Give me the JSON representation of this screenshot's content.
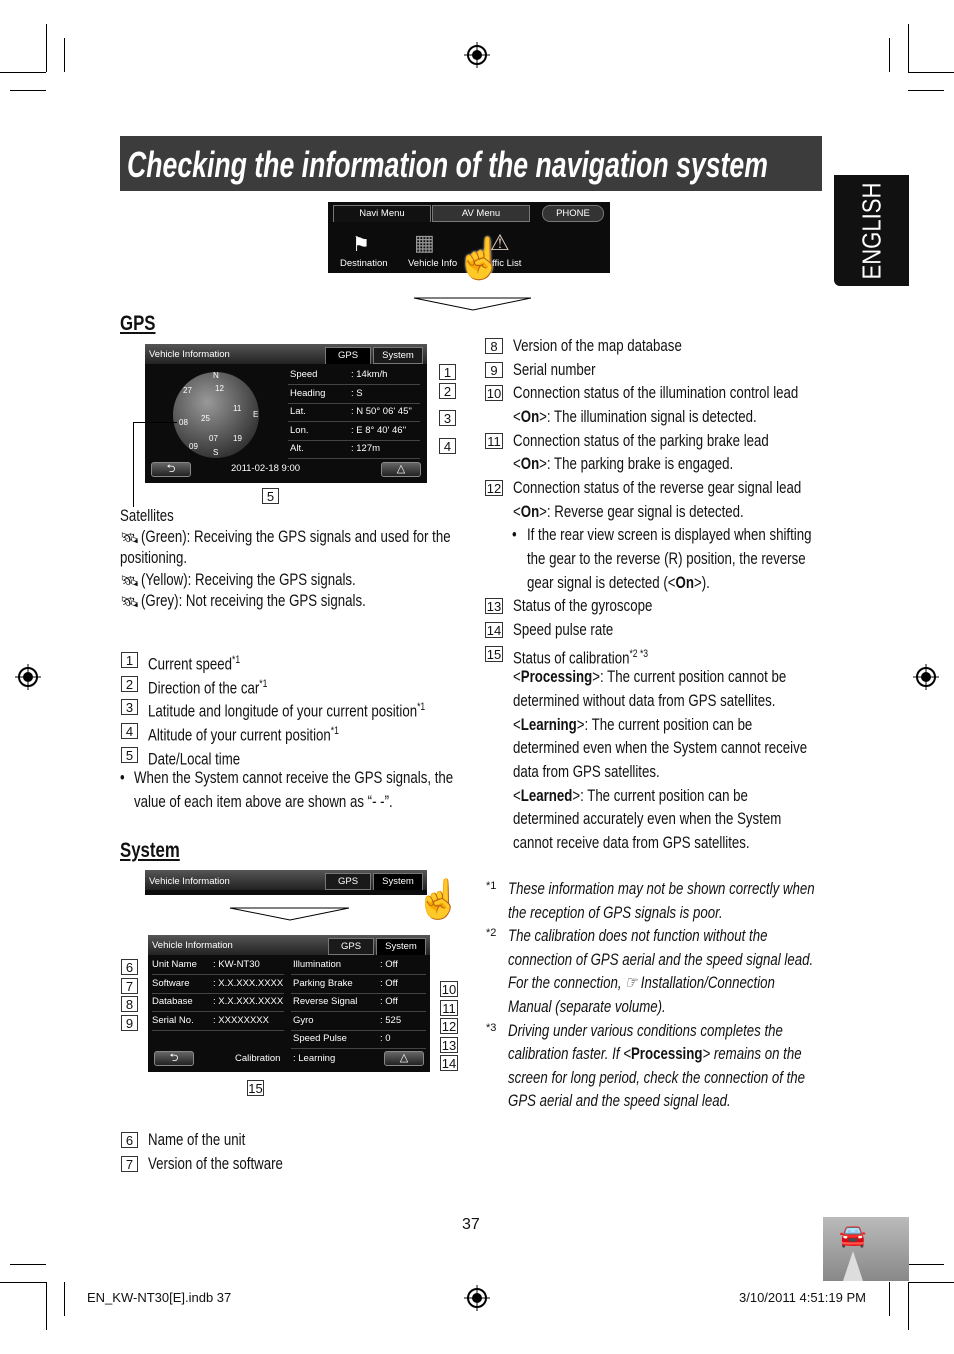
{
  "title": "Checking the information of the navigation system",
  "language_tab": "ENGLISH",
  "menu_screen": {
    "tabs": [
      "Navi Menu",
      "AV Menu",
      "PHONE"
    ],
    "items": [
      "Destination",
      "Vehicle Info",
      "Traffic List"
    ],
    "visible_items": [
      "Destination",
      "Vehicle Info",
      "ffic List"
    ]
  },
  "gps": {
    "heading": "GPS",
    "screen": {
      "title": "Vehicle Information",
      "tabs": [
        "GPS",
        "System"
      ],
      "rows": [
        {
          "label": "Speed",
          "value": ": 14km/h",
          "num": "1"
        },
        {
          "label": "Heading",
          "value": ": S",
          "num": "2"
        },
        {
          "label": "Lat.",
          "value": ": N 50° 06' 45''",
          "num": "3"
        },
        {
          "label": "Lon.",
          "value": ": E 8° 40' 46''",
          "num": ""
        },
        {
          "label": "Alt.",
          "value": ": 127m",
          "num": "4"
        }
      ],
      "satellites": [
        "27",
        "12",
        "25",
        "11",
        "08",
        "07",
        "19",
        "09"
      ],
      "compass": [
        "N",
        "E",
        "S",
        "W"
      ],
      "datetime": "2011-02-18   9:00",
      "datetime_num": "5"
    },
    "satellites_label": "Satellites",
    "satellite_notes": [
      "(Green): Receiving the GPS signals and used for the",
      "positioning.",
      "(Yellow): Receiving the GPS signals.",
      "(Grey): Not receiving the GPS signals."
    ],
    "items": [
      {
        "num": "1",
        "text": "Current speed",
        "sup": "*1"
      },
      {
        "num": "2",
        "text": "Direction of the car",
        "sup": "*1"
      },
      {
        "num": "3",
        "text": "Latitude and longitude of your current position",
        "sup": "*1"
      },
      {
        "num": "4",
        "text": "Altitude of your current position",
        "sup": "*1"
      },
      {
        "num": "5",
        "text": "Date/Local time",
        "sup": ""
      }
    ],
    "bullet": [
      "When the System cannot receive the GPS signals, the",
      "value of each item above are shown as “- -”."
    ]
  },
  "system": {
    "heading": "System",
    "tab_screen": {
      "title": "Vehicle Information",
      "tabs": [
        "GPS",
        "System"
      ]
    },
    "screen": {
      "title": "Vehicle Information",
      "tabs": [
        "GPS",
        "System"
      ],
      "left": [
        {
          "num": "6",
          "label": "Unit Name",
          "value": ": KW-NT30"
        },
        {
          "num": "7",
          "label": "Software",
          "value": ": X.X.XXX.XXXX"
        },
        {
          "num": "8",
          "label": "Database",
          "value": ": X.X.XXX.XXXX"
        },
        {
          "num": "9",
          "label": "Serial No.",
          "value": ": XXXXXXXX"
        }
      ],
      "right": [
        {
          "num": "10",
          "label": "Illumination",
          "value": ": Off"
        },
        {
          "num": "11",
          "label": "Parking Brake",
          "value": ": Off"
        },
        {
          "num": "12",
          "label": "Reverse Signal",
          "value": ": Off"
        },
        {
          "num": "13",
          "label": "Gyro",
          "value": ": 525"
        },
        {
          "num": "14",
          "label": "Speed Pulse",
          "value": ": 0"
        }
      ],
      "calibration_label": "Calibration",
      "calibration_value": ": Learning",
      "calibration_num": "15"
    },
    "items": [
      {
        "num": "6",
        "text": "Name of the unit"
      },
      {
        "num": "7",
        "text": "Version of the software"
      }
    ]
  },
  "right_column": [
    {
      "num": "8",
      "pre": "Version of the map database"
    },
    {
      "num": "9",
      "pre": "Serial number"
    },
    {
      "num": "10",
      "pre": "Connection status of the illumination control lead"
    },
    {
      "indent": 1,
      "pre": "<",
      "bold": "On",
      "post": ">: The illumination signal is detected."
    },
    {
      "num": "11",
      "pre": "Connection status of the parking brake lead"
    },
    {
      "indent": 1,
      "pre": "<",
      "bold": "On",
      "post": ">: The parking brake is engaged."
    },
    {
      "num": "12",
      "pre": "Connection status of the reverse gear signal lead"
    },
    {
      "indent": 1,
      "pre": "<",
      "bold": "On",
      "post": ">: Reverse gear signal is detected."
    },
    {
      "indent": 2,
      "bullet": "•",
      "pre": "If the rear view screen is displayed when shifting"
    },
    {
      "indent": 2,
      "pre": "the gear to the reverse (R) position, the reverse"
    },
    {
      "indent": 2,
      "pre": "gear signal is detected (<",
      "bold": "On",
      "post": ">)."
    },
    {
      "num": "13",
      "pre": "Status of the gyroscope"
    },
    {
      "num": "14",
      "pre": "Speed pulse rate"
    },
    {
      "num": "15",
      "pre": "Status of calibration",
      "sup": "*2 *3"
    },
    {
      "indent": 1,
      "pre": "<",
      "bold": "Processing",
      "post": ">: The current position cannot be"
    },
    {
      "indent": 1,
      "pre": "determined without data from GPS satellites."
    },
    {
      "indent": 1,
      "pre": "<",
      "bold": "Learning",
      "post": ">: The current position can be"
    },
    {
      "indent": 1,
      "pre": "determined even when the System cannot receive"
    },
    {
      "indent": 1,
      "pre": "data from GPS satellites."
    },
    {
      "indent": 1,
      "pre": "<",
      "bold": "Learned",
      "post": ">: The current position can be"
    },
    {
      "indent": 1,
      "pre": "determined accurately even when the System"
    },
    {
      "indent": 1,
      "pre": "cannot receive data from GPS satellites."
    }
  ],
  "footnotes": [
    {
      "mark": "*1",
      "pre": "These information may not be shown correctly when"
    },
    {
      "pre": "the reception of GPS signals is poor."
    },
    {
      "mark": "*2",
      "pre": "The calibration does not function without the"
    },
    {
      "pre": "connection of GPS aerial and the speed signal lead."
    },
    {
      "pre": "For the connection, ☞ Installation/Connection"
    },
    {
      "pre": "Manual (separate volume)."
    },
    {
      "mark": "*3",
      "pre": "Driving under various conditions completes the"
    },
    {
      "pre": "calibration faster. If <",
      "bold": "Processing",
      "post": "> remains on the"
    },
    {
      "pre": "screen for long period, check the connection of the"
    },
    {
      "pre": "GPS aerial and the speed signal lead."
    }
  ],
  "page_number": "37",
  "footer": {
    "file": "EN_KW-NT30[E].indb   37",
    "date": "3/10/2011   4:51:19 PM"
  }
}
